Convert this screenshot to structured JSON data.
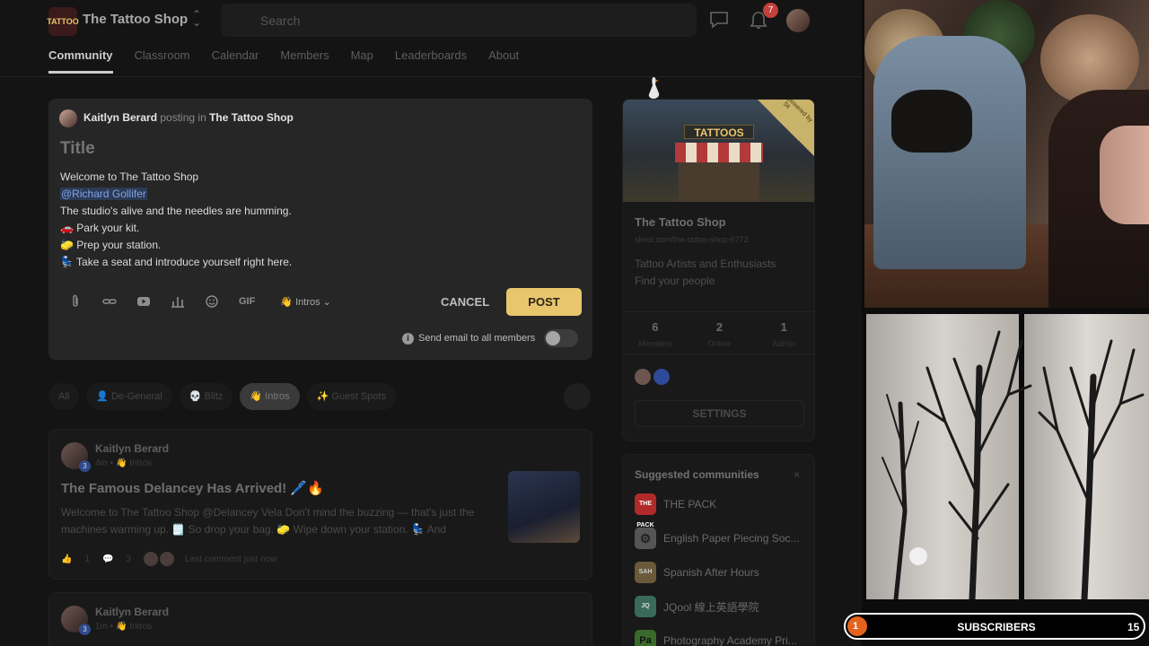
{
  "header": {
    "logo_text": "TATTOO",
    "group_name": "The Tattoo Shop",
    "search_placeholder": "Search",
    "notification_count": "7"
  },
  "nav": {
    "tabs": [
      {
        "label": "Community",
        "active": true
      },
      {
        "label": "Classroom"
      },
      {
        "label": "Calendar"
      },
      {
        "label": "Members"
      },
      {
        "label": "Map"
      },
      {
        "label": "Leaderboards"
      },
      {
        "label": "About"
      }
    ]
  },
  "composer": {
    "author": "Kaitlyn Berard",
    "posting_in": "posting in",
    "group": "The Tattoo Shop",
    "title_placeholder": "Title",
    "lines": [
      "Welcome to The Tattoo Shop",
      "@Richard Gollifer",
      "The studio's alive and the needles are humming.",
      "🚗 Park your kit.",
      "🧽 Prep your station.",
      "💺 Take a seat and introduce yourself right here."
    ],
    "gif_label": "GIF",
    "category": "👋 Intros",
    "cancel_label": "CANCEL",
    "post_label": "POST",
    "email_label": "Send email to all members"
  },
  "filters": [
    "All",
    "👤 De-General",
    "💀 Blitz",
    "👋 Intros",
    "✨ Guest Spots"
  ],
  "posts": [
    {
      "author": "Kaitlyn Berard",
      "level": "3",
      "meta": "4m • 👋 Intros",
      "title": "The Famous Delancey Has Arrived! 🖊️🔥",
      "excerpt": "Welcome to The Tattoo Shop @Delancey Vela Don't mind the buzzing — that's just the machines warming up. 🗒️ So drop your bag. 🧽 Wipe down your station. 💺 And",
      "likes": "1",
      "comments": "3",
      "last_comment": "Last comment just now"
    },
    {
      "author": "Kaitlyn Berard",
      "level": "3",
      "meta": "1m • 👋 Intros"
    }
  ],
  "sidebar": {
    "sign_text": "TATTOOS",
    "ribbon": "powered by Sk",
    "name": "The Tattoo Shop",
    "url": "skool.com/the-tattoo-shop-6772",
    "desc": [
      "Tattoo Artists and Enthusiasts",
      "Find your people"
    ],
    "stats": [
      {
        "n": "6",
        "l": "Members"
      },
      {
        "n": "2",
        "l": "Online"
      },
      {
        "n": "1",
        "l": "Admin"
      }
    ],
    "settings_label": "SETTINGS"
  },
  "suggested": {
    "title": "Suggested communities",
    "close": "×",
    "items": [
      {
        "label": "THE PACK",
        "icon": "THE PACK",
        "color": "#b02a2a"
      },
      {
        "label": "English Paper Piecing Soc...",
        "icon": "⚙",
        "color": "#555555"
      },
      {
        "label": "Spanish After Hours",
        "icon": "SAH",
        "color": "#6b5a3a"
      },
      {
        "label": "JQool 線上英語學院",
        "icon": "JQ",
        "color": "#3a6a5a"
      },
      {
        "label": "Photography Academy Pri...",
        "icon": "Pa",
        "color": "#3a6a2a"
      }
    ]
  },
  "stream": {
    "sub_current": "1",
    "sub_label": "SUBSCRIBERS",
    "sub_goal": "15"
  }
}
